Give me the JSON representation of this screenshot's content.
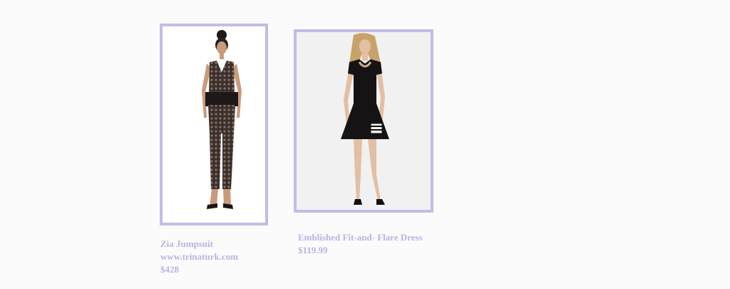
{
  "products": [
    {
      "name": "Zia Jumpsuit",
      "source": "www.trinaturk.com",
      "price": "$428"
    },
    {
      "name": "Emblished Fit-and- Flare Dress",
      "price": "$119.99"
    }
  ],
  "colors": {
    "frame_border": "#c3bce6",
    "caption_text": "#b9b3e2",
    "page_background": "#fbfbfc"
  }
}
